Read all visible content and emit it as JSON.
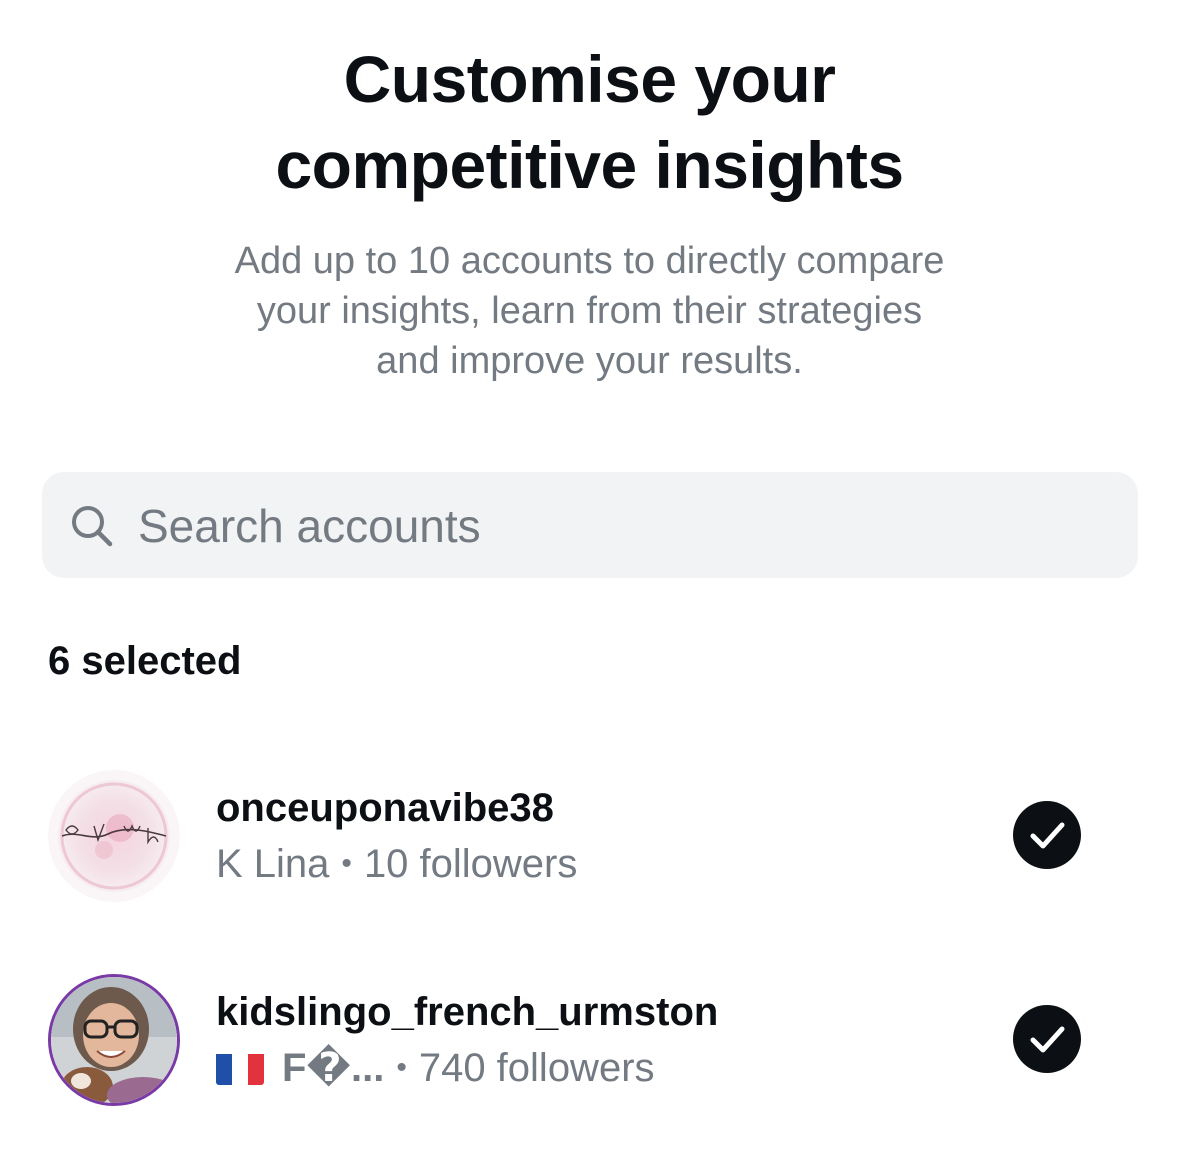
{
  "header": {
    "title_line1": "Customise your",
    "title_line2": "competitive insights",
    "subtitle_line1": "Add up to 10 accounts to directly compare",
    "subtitle_line2": "your insights, learn from their strategies",
    "subtitle_line3": "and improve your results."
  },
  "search": {
    "placeholder": "Search accounts",
    "icon": "search-icon"
  },
  "selection": {
    "count_label": "6 selected"
  },
  "accounts": [
    {
      "username": "onceuponavibe38",
      "name": "K Lina",
      "separator": "•",
      "followers": "10 followers",
      "avatar_text": "Once Upon a Vibe",
      "selected": true,
      "check_icon": "check-circle-icon"
    },
    {
      "username": "kidslingo_french_urmston",
      "flag": "flag-france-icon",
      "name": "F�...",
      "separator": "•",
      "followers": "740 followers",
      "selected": true,
      "check_icon": "check-circle-icon"
    }
  ],
  "colors": {
    "primary_text": "#0c1014",
    "secondary_text": "#737a82",
    "search_bg": "#f2f3f5",
    "check_bg": "#0c1014",
    "avatar_ring": "#7a3aa6"
  }
}
